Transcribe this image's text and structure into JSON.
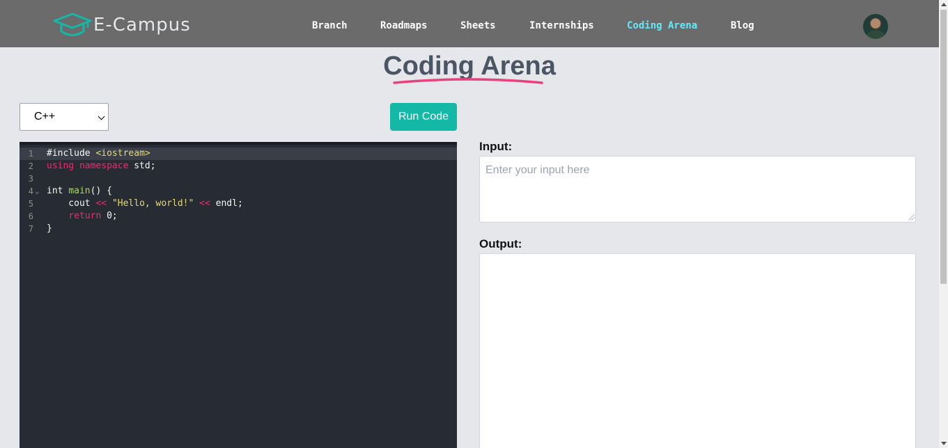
{
  "brand": {
    "logo_text": "E-Campus",
    "logo_color": "#14b8a6"
  },
  "nav": {
    "links": [
      {
        "label": "Branch"
      },
      {
        "label": "Roadmaps"
      },
      {
        "label": "Sheets"
      },
      {
        "label": "Internships"
      },
      {
        "label": "Coding Arena",
        "active": true
      },
      {
        "label": "Blog"
      }
    ],
    "active_color": "#67e8f9"
  },
  "page": {
    "title": "Coding Arena",
    "underline_color": "#ec407a"
  },
  "toolbar": {
    "language_selected": "C++",
    "run_label": "Run Code",
    "run_color": "#14b8a6"
  },
  "editor": {
    "lines": [
      {
        "num": "1",
        "text": "#include <iostream>"
      },
      {
        "num": "2",
        "text": "using namespace std;"
      },
      {
        "num": "3",
        "text": ""
      },
      {
        "num": "4",
        "text": "int main() {"
      },
      {
        "num": "5",
        "text": "    cout << \"Hello, world!\" << endl;"
      },
      {
        "num": "6",
        "text": "    return 0;"
      },
      {
        "num": "7",
        "text": "}"
      }
    ]
  },
  "io": {
    "input_label": "Input:",
    "input_placeholder": "Enter your input here",
    "input_value": "",
    "output_label": "Output:",
    "output_value": ""
  }
}
